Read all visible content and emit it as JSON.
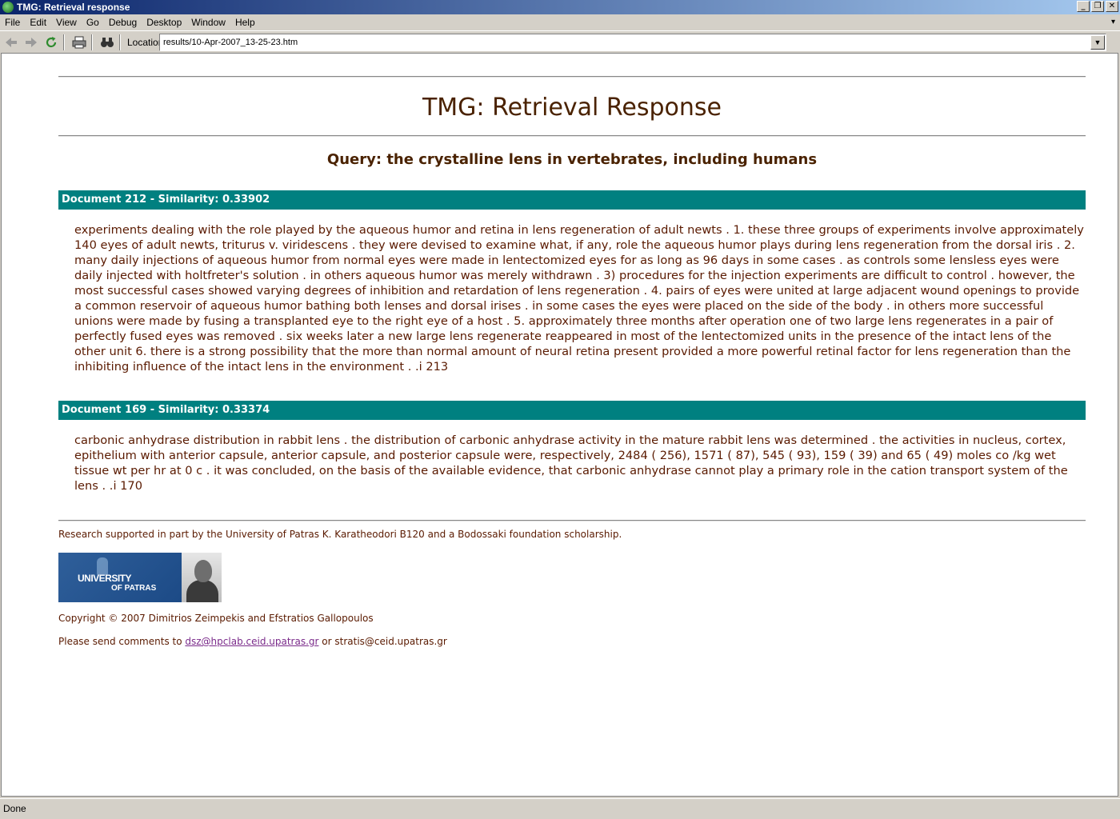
{
  "window": {
    "title": "TMG: Retrieval response"
  },
  "menu": [
    "File",
    "Edit",
    "View",
    "Go",
    "Debug",
    "Desktop",
    "Window",
    "Help"
  ],
  "toolbar": {
    "location_label": "Location:",
    "location_value": "results/10-Apr-2007_13-25-23.htm"
  },
  "page": {
    "title": "TMG: Retrieval Response",
    "query": "Query: the crystalline lens in vertebrates, including humans",
    "documents": [
      {
        "header": "Document 212 - Similarity: 0.33902",
        "text": "experiments dealing with the role played by the aqueous humor and retina in lens regeneration of adult newts . 1. these three groups of experiments involve approximately 140 eyes of adult newts, triturus v. viridescens . they were devised to examine what, if any, role the aqueous humor plays during lens regeneration from the dorsal iris . 2. many daily injections of aqueous humor from normal eyes were made in lentectomized eyes for as long as 96 days in some cases . as controls some lensless eyes were daily injected with holtfreter's solution . in others aqueous humor was merely withdrawn . 3) procedures for the injection experiments are difficult to control . however, the most successful cases showed varying degrees of inhibition and retardation of lens regeneration . 4. pairs of eyes were united at large adjacent wound openings to provide a common reservoir of aqueous humor bathing both lenses and dorsal irises . in some cases the eyes were placed on the side of the body . in others more successful unions were made by fusing a transplanted eye to the right eye of a host . 5. approximately three months after operation one of two large lens regenerates in a pair of perfectly fused eyes was removed . six weeks later a new large lens regenerate reappeared in most of the lentectomized units in the presence of the intact lens of the other unit 6. there is a strong possibility that the more than normal amount of neural retina present provided a more powerful retinal factor for lens regeneration than the inhibiting influence of the intact lens in the environment . .i 213"
      },
      {
        "header": "Document 169 - Similarity: 0.33374",
        "text": "carbonic anhydrase distribution in rabbit lens . the distribution of carbonic anhydrase activity in the mature rabbit lens was determined . the activities in nucleus, cortex, epithelium with anterior capsule, anterior capsule, and posterior capsule were, respectively, 2484 ( 256), 1571 ( 87), 545 ( 93), 159 ( 39) and 65 ( 49) moles co /kg wet tissue wt per hr at 0 c . it was concluded, on the basis of the available evidence, that carbonic anhydrase cannot play a primary role in the cation transport system of the lens . .i 170"
      }
    ],
    "footer": {
      "research": "Research supported in part by the University of Patras K. Karatheodori B120 and a Bodossaki foundation scholarship.",
      "logo_line1": "UNIVERSITY",
      "logo_line2": "OF PATRAS",
      "copyright": "Copyright © 2007 Dimitrios Zeimpekis and Efstratios Gallopoulos",
      "comments_prefix": "Please send comments to",
      "email_link": "dsz@hpclab.ceid.upatras.gr",
      "comments_mid": "or",
      "email_plain": "stratis@ceid.upatras.gr"
    }
  },
  "status": {
    "text": "Done"
  },
  "icons": [
    "back-icon",
    "forward-icon",
    "reload-icon",
    "print-icon",
    "find-icon",
    "dropdown-arrow-icon"
  ],
  "colors": {
    "header_teal": "#008080",
    "text_brown": "#5a1a00",
    "titlebar": "#0a246a"
  }
}
